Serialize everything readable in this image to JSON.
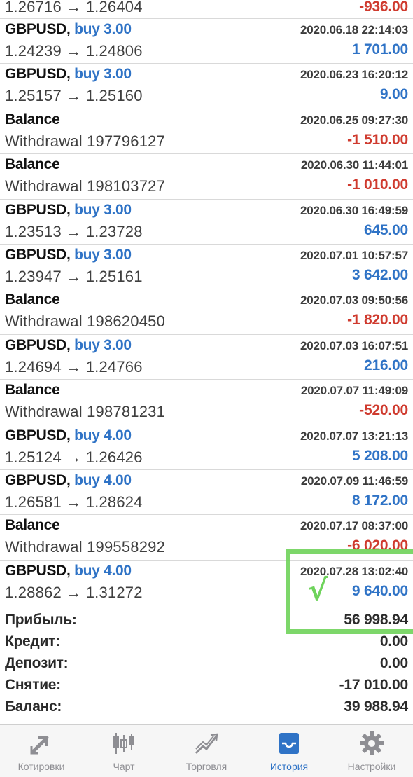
{
  "history": [
    {
      "line2": "1.26716 → 1.26404",
      "amount": "-936.00",
      "sign": "neg"
    },
    {
      "symbol": "GBPUSD,",
      "action": "buy 3.00",
      "time": "2020.06.18 22:14:03",
      "line2": "1.24239 → 1.24806",
      "amount": "1 701.00",
      "sign": "pos"
    },
    {
      "symbol": "GBPUSD,",
      "action": "buy 3.00",
      "time": "2020.06.23 16:20:12",
      "line2": "1.25157 → 1.25160",
      "amount": "9.00",
      "sign": "pos"
    },
    {
      "symbol": "Balance",
      "action": "",
      "time": "2020.06.25 09:27:30",
      "line2": "Withdrawal 197796127",
      "amount": "-1 510.00",
      "sign": "neg"
    },
    {
      "symbol": "Balance",
      "action": "",
      "time": "2020.06.30 11:44:01",
      "line2": "Withdrawal 198103727",
      "amount": "-1 010.00",
      "sign": "neg"
    },
    {
      "symbol": "GBPUSD,",
      "action": "buy 3.00",
      "time": "2020.06.30 16:49:59",
      "line2": "1.23513 → 1.23728",
      "amount": "645.00",
      "sign": "pos"
    },
    {
      "symbol": "GBPUSD,",
      "action": "buy 3.00",
      "time": "2020.07.01 10:57:57",
      "line2": "1.23947 → 1.25161",
      "amount": "3 642.00",
      "sign": "pos"
    },
    {
      "symbol": "Balance",
      "action": "",
      "time": "2020.07.03 09:50:56",
      "line2": "Withdrawal 198620450",
      "amount": "-1 820.00",
      "sign": "neg"
    },
    {
      "symbol": "GBPUSD,",
      "action": "buy 3.00",
      "time": "2020.07.03 16:07:51",
      "line2": "1.24694 → 1.24766",
      "amount": "216.00",
      "sign": "pos"
    },
    {
      "symbol": "Balance",
      "action": "",
      "time": "2020.07.07 11:49:09",
      "line2": "Withdrawal 198781231",
      "amount": "-520.00",
      "sign": "neg"
    },
    {
      "symbol": "GBPUSD,",
      "action": "buy 4.00",
      "time": "2020.07.07 13:21:13",
      "line2": "1.25124 → 1.26426",
      "amount": "5 208.00",
      "sign": "pos"
    },
    {
      "symbol": "GBPUSD,",
      "action": "buy 4.00",
      "time": "2020.07.09 11:46:59",
      "line2": "1.26581 → 1.28624",
      "amount": "8 172.00",
      "sign": "pos"
    },
    {
      "symbol": "Balance",
      "action": "",
      "time": "2020.07.17 08:37:00",
      "line2": "Withdrawal 199558292",
      "amount": "-6 020.00",
      "sign": "neg"
    },
    {
      "symbol": "GBPUSD,",
      "action": "buy 4.00",
      "time": "2020.07.28 13:02:40",
      "line2": "1.28862 → 1.31272",
      "amount": "9 640.00",
      "sign": "pos"
    }
  ],
  "summary": [
    {
      "label": "Прибыль:",
      "value": "56 998.94"
    },
    {
      "label": "Кредит:",
      "value": "0.00"
    },
    {
      "label": "Депозит:",
      "value": "0.00"
    },
    {
      "label": "Снятие:",
      "value": "-17 010.00"
    },
    {
      "label": "Баланс:",
      "value": "39 988.94"
    }
  ],
  "annotation": {
    "checkmark": "√",
    "color": "#6fd35a"
  },
  "tabs": [
    {
      "label": "Котировки",
      "icon": "quotes-icon"
    },
    {
      "label": "Чарт",
      "icon": "chart-candles-icon"
    },
    {
      "label": "Торговля",
      "icon": "trade-icon"
    },
    {
      "label": "История",
      "icon": "history-inbox-icon",
      "active": true
    },
    {
      "label": "Настройки",
      "icon": "gear-icon"
    }
  ],
  "colors": {
    "accent": "#2f73c6",
    "negative": "#cf3a2e",
    "inactive_tab": "#8e8e93"
  }
}
